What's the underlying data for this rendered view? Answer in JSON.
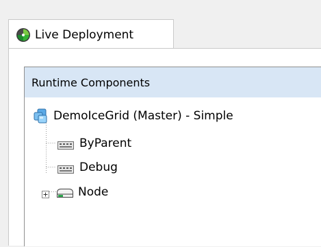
{
  "tab": {
    "label": "Live Deployment",
    "icon": "live-deployment-icon"
  },
  "panel": {
    "title": "Runtime Components"
  },
  "tree": {
    "root": {
      "label": "DemoIceGrid (Master) - Simple",
      "icon": "icegrid-registry-icon"
    },
    "children": [
      {
        "label": "ByParent",
        "icon": "application-icon"
      },
      {
        "label": "Debug",
        "icon": "application-icon"
      },
      {
        "label": "Node",
        "icon": "node-icon",
        "expander": "plus"
      }
    ]
  },
  "colors": {
    "panel_header_bg": "#d8e6f5",
    "window_bg": "#f0f0f0",
    "node_green": "#2fa84f"
  }
}
